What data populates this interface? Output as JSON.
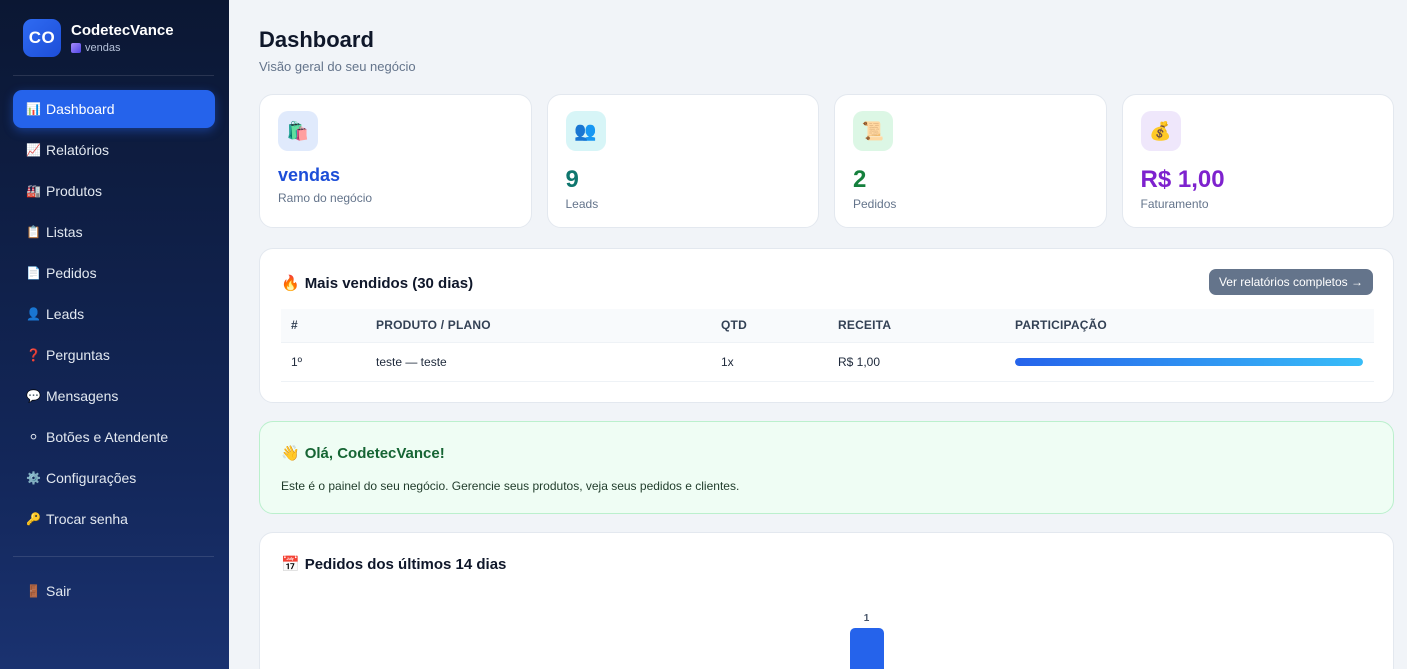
{
  "brand": {
    "logo": "CO",
    "name": "CodetecVance",
    "subtitle": "vendas"
  },
  "nav": {
    "items": [
      {
        "icon": "📊",
        "label": "Dashboard",
        "active": true
      },
      {
        "icon": "📈",
        "label": "Relatórios"
      },
      {
        "icon": "🏭",
        "label": "Produtos"
      },
      {
        "icon": "📋",
        "label": "Listas"
      },
      {
        "icon": "📄",
        "label": "Pedidos"
      },
      {
        "icon": "👤",
        "label": "Leads"
      },
      {
        "icon": "❓",
        "label": "Perguntas"
      },
      {
        "icon": "💬",
        "label": "Mensagens"
      },
      {
        "icon": "⚪",
        "label": "Botões e Atendente"
      },
      {
        "icon": "⚙️",
        "label": "Configurações"
      },
      {
        "icon": "🔑",
        "label": "Trocar senha"
      }
    ],
    "logout": {
      "icon": "🚪",
      "label": "Sair"
    }
  },
  "header": {
    "title": "Dashboard",
    "subtitle": "Visão geral do seu negócio"
  },
  "stats": [
    {
      "icon": "🛍️",
      "value": "vendas",
      "label": "Ramo do negócio",
      "color": "#1d4ed8",
      "icon_bg": "#e0eafc"
    },
    {
      "icon": "👥",
      "value": "9",
      "label": "Leads",
      "color": "#0f766e",
      "icon_bg": "#d7f5f7"
    },
    {
      "icon": "📜",
      "value": "2",
      "label": "Pedidos",
      "color": "#15803d",
      "icon_bg": "#dcf7e5"
    },
    {
      "icon": "💰",
      "value": "R$ 1,00",
      "label": "Faturamento",
      "color": "#7e22ce",
      "icon_bg": "#efe7fb"
    }
  ],
  "top_sellers": {
    "icon": "🔥",
    "title": "Mais vendidos (30 dias)",
    "button": "Ver relatórios completos →",
    "columns": [
      "#",
      "PRODUTO / PLANO",
      "QTD",
      "RECEITA",
      "PARTICIPAÇÃO"
    ],
    "rows": [
      {
        "rank": "1º",
        "product": "teste — teste",
        "qty": "1x",
        "revenue": "R$ 1,00",
        "share": 1.0
      }
    ]
  },
  "welcome": {
    "icon": "👋",
    "title": "Olá, CodetecVance!",
    "text": "Este é o painel do seu negócio. Gerencie seus produtos, veja seus pedidos e clientes."
  },
  "orders_chart": {
    "icon": "📅",
    "title": "Pedidos dos últimos 14 dias"
  },
  "chart_data": {
    "type": "bar",
    "title": "Pedidos dos últimos 14 dias",
    "categories": [
      "",
      "",
      "",
      "",
      "",
      "",
      "",
      "",
      "",
      "",
      "",
      "",
      "",
      ""
    ],
    "values": [
      0,
      0,
      0,
      0,
      0,
      0,
      0,
      1,
      0,
      0,
      0,
      0,
      0,
      0
    ],
    "data_labels": [
      "",
      "",
      "",
      "",
      "",
      "",
      "",
      "1",
      "",
      "",
      "",
      "",
      "",
      ""
    ],
    "ylim": [
      0,
      1
    ],
    "grid": false
  }
}
